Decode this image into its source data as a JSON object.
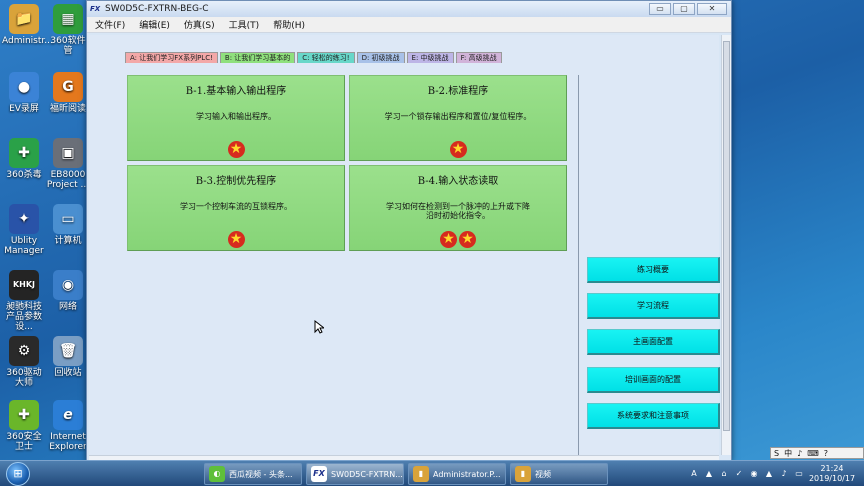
{
  "desktop": {
    "icons": [
      {
        "label": "Administr...",
        "glyph": "📁",
        "color": "#d9a33a"
      },
      {
        "label": "360软件管",
        "glyph": "▦",
        "color": "#2f9d3c"
      },
      {
        "label": "EV录屏",
        "glyph": "●",
        "color": "#3b83d6"
      },
      {
        "label": "福昕阅读",
        "glyph": "G",
        "color": "#e4781d"
      },
      {
        "label": "360杀毒",
        "glyph": "✚",
        "color": "#2aa148"
      },
      {
        "label": "EB8000 Project ...",
        "glyph": "▣",
        "color": "#6a6f78"
      },
      {
        "label": "Ublity Manager",
        "glyph": "✦",
        "color": "#2953a8"
      },
      {
        "label": "计算机",
        "glyph": "▭",
        "color": "#4a8fd0"
      },
      {
        "label": "昶驰科技产品参数设...",
        "glyph": "KHKJ",
        "color": "#242424"
      },
      {
        "label": "网络",
        "glyph": "◉",
        "color": "#3a7ec9"
      },
      {
        "label": "360驱动大师",
        "glyph": "⚙",
        "color": "#2a2a2a"
      },
      {
        "label": "回收站",
        "glyph": "🗑",
        "color": "#7a9ec4"
      },
      {
        "label": "360安全卫士",
        "glyph": "✚",
        "color": "#6ab62a"
      },
      {
        "label": "Internet Explorer",
        "glyph": "e",
        "color": "#2b7ed6"
      }
    ]
  },
  "window": {
    "title": "SW0D5C-FXTRN-BEG-C",
    "app_icon": "FX",
    "buttons": {
      "minimize": "▭",
      "maximize": "▢",
      "close": "✕"
    },
    "menu": [
      "文件(F)",
      "编辑(E)",
      "仿真(S)",
      "工具(T)",
      "帮助(H)"
    ]
  },
  "tabs": [
    {
      "label": "A: 让我们学习FX系列PLC!",
      "color": "#f3a8a8"
    },
    {
      "label": "B: 让我们学习基本的",
      "color": "#8fe07d"
    },
    {
      "label": "C: 轻松的练习!",
      "color": "#68d7c9"
    },
    {
      "label": "D: 初级挑战",
      "color": "#a8c1e8"
    },
    {
      "label": "E: 中级挑战",
      "color": "#bdb5e6"
    },
    {
      "label": "F: 高级挑战",
      "color": "#d1b3d9"
    }
  ],
  "lessons": [
    {
      "title": "B-1.基本输入输出程序",
      "desc": "学习输入和输出程序。",
      "stars": 1
    },
    {
      "title": "B-2.标准程序",
      "desc": "学习一个锁存输出程序和置位/复位程序。",
      "stars": 1
    },
    {
      "title": "B-3.控制优先程序",
      "desc": "学习一个控制车流的互锁程序。",
      "stars": 1
    },
    {
      "title": "B-4.输入状态读取",
      "desc": "学习如何在检测到一个脉冲的上升或下降沿时初始化指令。",
      "stars": 2
    }
  ],
  "side_buttons": [
    "练习概要",
    "学习流程",
    "主画面配置",
    "培训画面的配置",
    "系统要求和注意事项"
  ],
  "star_glyph": "★",
  "language_bar": [
    "S",
    "中",
    "♪",
    "⌨",
    "?"
  ],
  "taskbar": {
    "start_glyph": "⊞",
    "tasks": [
      {
        "label": "西瓜视频 - 头条...",
        "icon": "◐",
        "color": "#5fbf3a"
      },
      {
        "label": "SW0D5C-FXTRN...",
        "icon": "FX",
        "color": "#ffffff"
      },
      {
        "label": "Administrator.P...",
        "icon": "▮",
        "color": "#d9a33a"
      },
      {
        "label": "视频",
        "icon": "▮",
        "color": "#d9a33a"
      }
    ],
    "tray": [
      "A",
      "▲",
      "⌂",
      "✓",
      "◉",
      "▲",
      "♪",
      "▭"
    ],
    "time": "21:24",
    "date": "2019/10/17"
  }
}
